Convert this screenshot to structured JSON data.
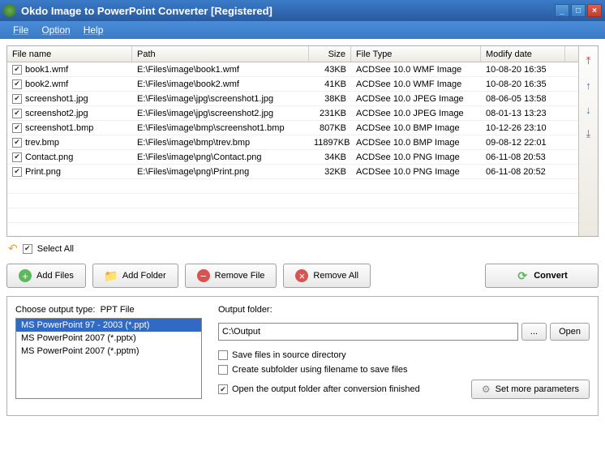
{
  "title": "Okdo Image to PowerPoint Converter [Registered]",
  "menu": {
    "file": "File",
    "option": "Option",
    "help": "Help"
  },
  "columns": {
    "name": "File name",
    "path": "Path",
    "size": "Size",
    "type": "File Type",
    "date": "Modify date"
  },
  "files": [
    {
      "name": "book1.wmf",
      "path": "E:\\Files\\image\\book1.wmf",
      "size": "43KB",
      "type": "ACDSee 10.0 WMF Image",
      "date": "10-08-20 16:35"
    },
    {
      "name": "book2.wmf",
      "path": "E:\\Files\\image\\book2.wmf",
      "size": "41KB",
      "type": "ACDSee 10.0 WMF Image",
      "date": "10-08-20 16:35"
    },
    {
      "name": "screenshot1.jpg",
      "path": "E:\\Files\\image\\jpg\\screenshot1.jpg",
      "size": "38KB",
      "type": "ACDSee 10.0 JPEG Image",
      "date": "08-06-05 13:58"
    },
    {
      "name": "screenshot2.jpg",
      "path": "E:\\Files\\image\\jpg\\screenshot2.jpg",
      "size": "231KB",
      "type": "ACDSee 10.0 JPEG Image",
      "date": "08-01-13 13:23"
    },
    {
      "name": "screenshot1.bmp",
      "path": "E:\\Files\\image\\bmp\\screenshot1.bmp",
      "size": "807KB",
      "type": "ACDSee 10.0 BMP Image",
      "date": "10-12-26 23:10"
    },
    {
      "name": "trev.bmp",
      "path": "E:\\Files\\image\\bmp\\trev.bmp",
      "size": "11897KB",
      "type": "ACDSee 10.0 BMP Image",
      "date": "09-08-12 22:01"
    },
    {
      "name": "Contact.png",
      "path": "E:\\Files\\image\\png\\Contact.png",
      "size": "34KB",
      "type": "ACDSee 10.0 PNG Image",
      "date": "06-11-08 20:53"
    },
    {
      "name": "Print.png",
      "path": "E:\\Files\\image\\png\\Print.png",
      "size": "32KB",
      "type": "ACDSee 10.0 PNG Image",
      "date": "06-11-08 20:52"
    }
  ],
  "selectAll": "Select All",
  "buttons": {
    "addFiles": "Add Files",
    "addFolder": "Add Folder",
    "removeFile": "Remove File",
    "removeAll": "Remove All",
    "convert": "Convert"
  },
  "outputTypeLabel": "Choose output type:",
  "outputTypeValue": "PPT File",
  "outputTypes": [
    "MS PowerPoint 97 - 2003 (*.ppt)",
    "MS PowerPoint 2007 (*.pptx)",
    "MS PowerPoint 2007 (*.pptm)"
  ],
  "outputFolderLabel": "Output folder:",
  "outputFolder": "C:\\Output",
  "browseBtn": "...",
  "openBtn": "Open",
  "checks": {
    "saveSource": "Save files in source directory",
    "subfolder": "Create subfolder using filename to save files",
    "openAfter": "Open the output folder after conversion finished"
  },
  "moreParams": "Set more parameters"
}
